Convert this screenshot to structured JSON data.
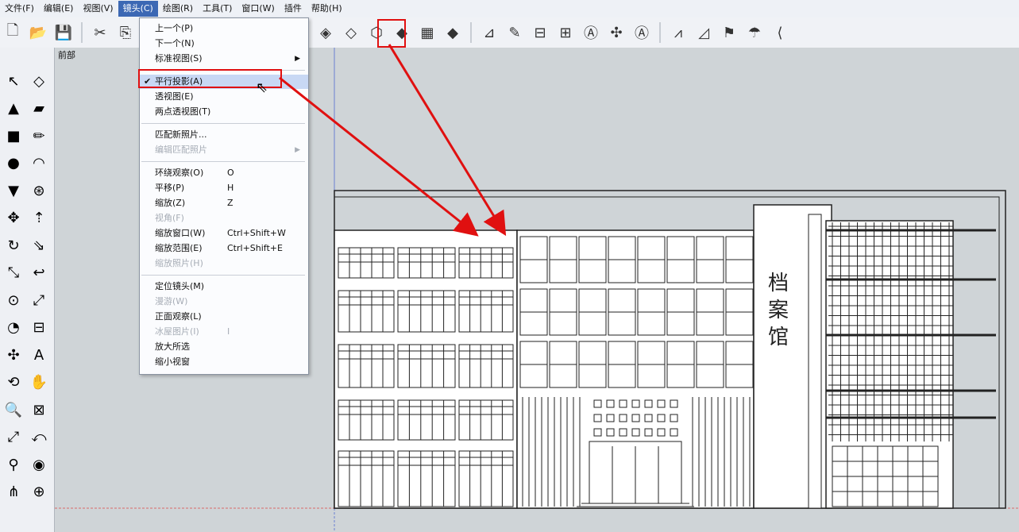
{
  "menubar": [
    "文件(F)",
    "编辑(E)",
    "视图(V)",
    "镜头(C)",
    "绘图(R)",
    "工具(T)",
    "窗口(W)",
    "插件",
    "帮助(H)"
  ],
  "active_menu_index": 3,
  "scene_tab": "前部",
  "camera_menu": [
    {
      "label": "上一个(P)"
    },
    {
      "label": "下一个(N)"
    },
    {
      "label": "标准视图(S)",
      "submenu": true
    },
    {
      "sep": true
    },
    {
      "label": "平行投影(A)",
      "checked": true
    },
    {
      "label": "透视图(E)"
    },
    {
      "label": "两点透视图(T)"
    },
    {
      "sep": true
    },
    {
      "label": "匹配新照片..."
    },
    {
      "label": "编辑匹配照片",
      "disabled": true,
      "submenu": true
    },
    {
      "sep": true
    },
    {
      "label": "环绕观察(O)",
      "key": "O"
    },
    {
      "label": "平移(P)",
      "key": "H"
    },
    {
      "label": "缩放(Z)",
      "key": "Z"
    },
    {
      "label": "视角(F)",
      "disabled": true
    },
    {
      "label": "缩放窗口(W)",
      "key": "Ctrl+Shift+W"
    },
    {
      "label": "缩放范围(E)",
      "key": "Ctrl+Shift+E"
    },
    {
      "label": "缩放照片(H)",
      "disabled": true
    },
    {
      "sep": true
    },
    {
      "label": "定位镜头(M)"
    },
    {
      "label": "漫游(W)",
      "disabled": true
    },
    {
      "label": "正面观察(L)"
    },
    {
      "label": "冰屋图片(I)",
      "key": "I",
      "disabled": true
    },
    {
      "label": "放大所选"
    },
    {
      "label": "缩小视窗"
    }
  ],
  "building_sign": [
    "档",
    "案",
    "馆"
  ],
  "icons": {
    "toolbar": [
      "new-file-icon",
      "open-folder-icon",
      "save-icon",
      "sep",
      "cut-icon",
      "copy-icon",
      "sep",
      "iso-view-icon",
      "top-view-icon",
      "front-view-icon",
      "right-view-icon",
      "back-view-icon",
      "left-view-icon",
      "sep",
      "xray-icon",
      "wireframe-icon",
      "hidden-line-icon",
      "shaded-icon",
      "textured-icon",
      "monochrome-icon",
      "sep",
      "section-plane-icon",
      "paint-icon",
      "measure-icon",
      "dimension-icon",
      "text-icon",
      "axes-icon",
      "3d-text-icon",
      "sep",
      "sandbox-icon",
      "drape-icon",
      "stamp-icon",
      "smoove-icon",
      "flip-edge-icon"
    ],
    "left": [
      "select-icon",
      "eraser-outline-icon",
      "paint-bucket-icon",
      "eraser-icon",
      "rectangle-icon",
      "pencil-icon",
      "circle-icon",
      "arc-icon",
      "polygon-icon",
      "freehand-icon",
      "move-icon",
      "push-pull-icon",
      "rotate-icon",
      "follow-me-icon",
      "scale-icon",
      "offset-icon",
      "tape-measure-icon",
      "dimension-tool-icon",
      "protractor-icon",
      "text-tool-icon",
      "axes-tool-icon",
      "3d-text-tool-icon",
      "orbit-icon",
      "pan-icon",
      "zoom-icon",
      "zoom-window-icon",
      "zoom-extents-icon",
      "previous-view-icon",
      "position-camera-icon",
      "look-around-icon",
      "walk-icon",
      "section-icon"
    ]
  },
  "accent_colors": {
    "highlight": "#e01010",
    "menu_active": "#3c68b4"
  }
}
